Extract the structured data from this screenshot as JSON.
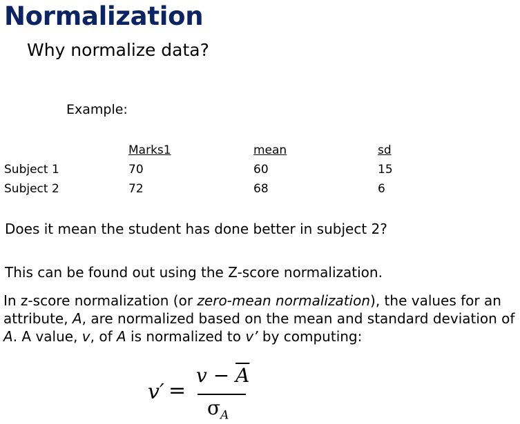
{
  "title": "Normalization",
  "subtitle": "Why normalize data?",
  "example_label": "Example:",
  "table": {
    "headers": [
      "Marks1",
      "mean",
      "sd"
    ],
    "rows": [
      {
        "label": "Subject 1",
        "marks": "70",
        "mean": "60",
        "sd": "15"
      },
      {
        "label": "Subject 2",
        "marks": "72",
        "mean": "68",
        "sd": "6"
      }
    ]
  },
  "question": "Does it mean the student has done better in subject 2?",
  "answer": "This can be found out using the Z-score normalization.",
  "paragraph": {
    "p1": "In z-score normalization (or ",
    "p2": "zero-mean normalization",
    "p3": "), the values for an attribute, ",
    "p4": "A",
    "p5": ", are normalized based on the mean and standard deviation of ",
    "p6": "A",
    "p7": ". A value, ",
    "p8": "v",
    "p9": ", of ",
    "p10": "A",
    "p11": " is normalized to ",
    "p12": "v’",
    "p13": " by computing:"
  },
  "formula": {
    "lhs": "v′",
    "eq": "=",
    "num_v": "v",
    "num_minus": " − ",
    "num_a": "A",
    "den_sigma": "σ",
    "den_sub": "A"
  }
}
